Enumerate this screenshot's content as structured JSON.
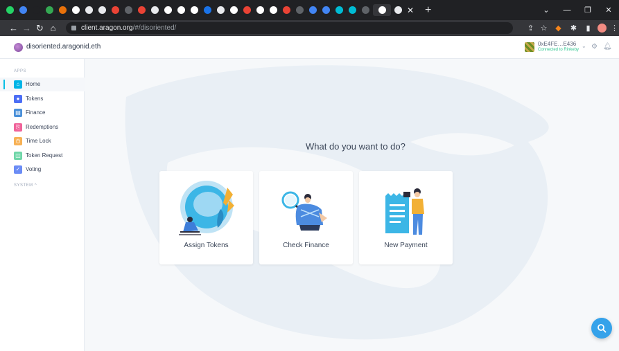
{
  "browser": {
    "tab_favicon_colors": [
      "#25d366",
      "#4285f4",
      "#202124",
      "#34a853",
      "#e8710a",
      "#ffffff",
      "#e8eaed",
      "#e8eaed",
      "#ea4335",
      "#5f6368",
      "#ea4335",
      "#e8eaed",
      "#ffffff",
      "#ffffff",
      "#ffffff",
      "#1a73e8",
      "#e8eaed",
      "#ffffff",
      "#ea4335",
      "#ffffff",
      "#ffffff",
      "#ea4335",
      "#5f6368",
      "#4285f4",
      "#4285f4",
      "#00bcd4",
      "#00bcd4",
      "#5f6368",
      "#ffffff",
      "#e8eaed"
    ],
    "url_host": "client.aragon.org",
    "url_path": "/#/disoriented/"
  },
  "header": {
    "org_name": "disoriented.aragonid.eth",
    "account_address": "0xE4FE…E436",
    "account_status": "Connected to Rinkeby"
  },
  "sidebar": {
    "apps_label": "APPS",
    "system_label": "SYSTEM ^",
    "items": [
      {
        "label": "Home",
        "icon": "home-icon",
        "color": "#00b4e6"
      },
      {
        "label": "Tokens",
        "icon": "tokens-icon",
        "color": "#4c6ef5"
      },
      {
        "label": "Finance",
        "icon": "finance-icon",
        "color": "#4a90d9"
      },
      {
        "label": "Redemptions",
        "icon": "redemptions-icon",
        "color": "#f0639a"
      },
      {
        "label": "Time Lock",
        "icon": "time-lock-icon",
        "color": "#f7b155"
      },
      {
        "label": "Token Request",
        "icon": "token-request-icon",
        "color": "#6fd6a8"
      },
      {
        "label": "Voting",
        "icon": "voting-icon",
        "color": "#6b8cf5"
      }
    ]
  },
  "main": {
    "question": "What do you want to do?",
    "cards": [
      {
        "label": "Assign Tokens",
        "icon": "assign-tokens-illustration"
      },
      {
        "label": "Check Finance",
        "icon": "check-finance-illustration"
      },
      {
        "label": "New Payment",
        "icon": "new-payment-illustration"
      }
    ]
  },
  "colors": {
    "accent": "#08bee5",
    "fab": "#35a2ea"
  }
}
